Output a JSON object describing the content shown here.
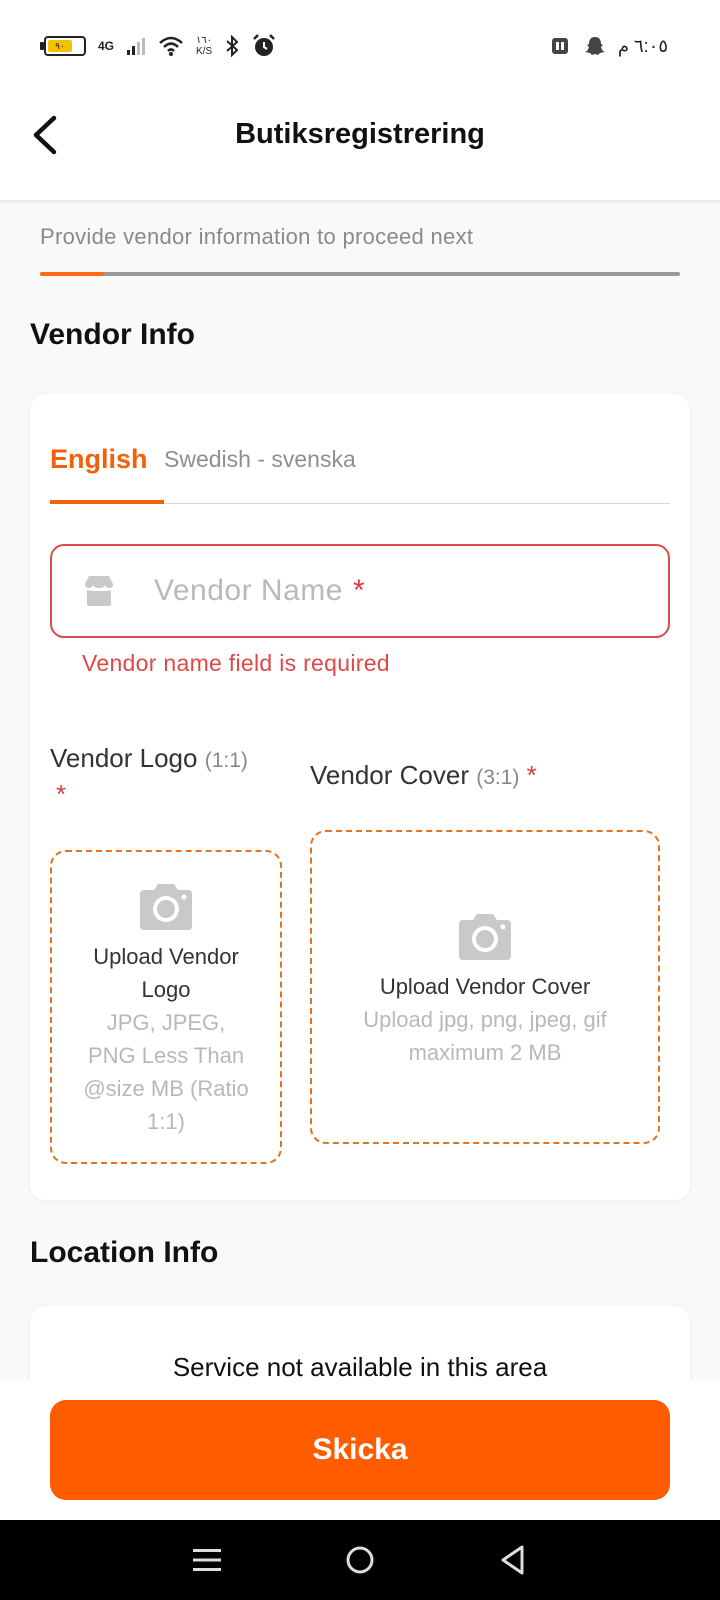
{
  "status_bar": {
    "battery": "٩٠",
    "network": "4G",
    "net_speed_value": "١٦٠",
    "net_speed_unit": "K/S",
    "time": "٦:٠٥ م"
  },
  "header": {
    "title": "Butiksregistrering"
  },
  "progress": {
    "text": "Provide vendor information to proceed next",
    "fraction": 0.1
  },
  "vendor_info": {
    "section_title": "Vendor Info",
    "tabs": [
      {
        "label": "English",
        "active": true
      },
      {
        "label": "Swedish - svenska",
        "active": false
      }
    ],
    "vendor_name_placeholder": "Vendor Name",
    "required_mark": "*",
    "error": "Vendor name field is required",
    "logo": {
      "label": "Vendor Logo",
      "ratio": "(1:1)",
      "upload_title": "Upload Vendor Logo",
      "hint": "JPG, JPEG, PNG Less Than @size MB (Ratio 1:1)"
    },
    "cover": {
      "label": "Vendor Cover",
      "ratio": "(3:1)",
      "upload_title": "Upload Vendor Cover",
      "hint": "Upload jpg, png, jpeg, gif maximum 2 MB"
    }
  },
  "location_info": {
    "section_title": "Location Info",
    "message": "Service not available in this area"
  },
  "submit_label": "Skicka",
  "colors": {
    "accent": "#ff5c00",
    "error": "#dc4c4c",
    "muted": "#8f8f8f"
  },
  "icons": [
    "back-arrow-icon",
    "store-icon",
    "camera-icon",
    "menu-icon",
    "home-icon",
    "back-triangle-icon"
  ]
}
